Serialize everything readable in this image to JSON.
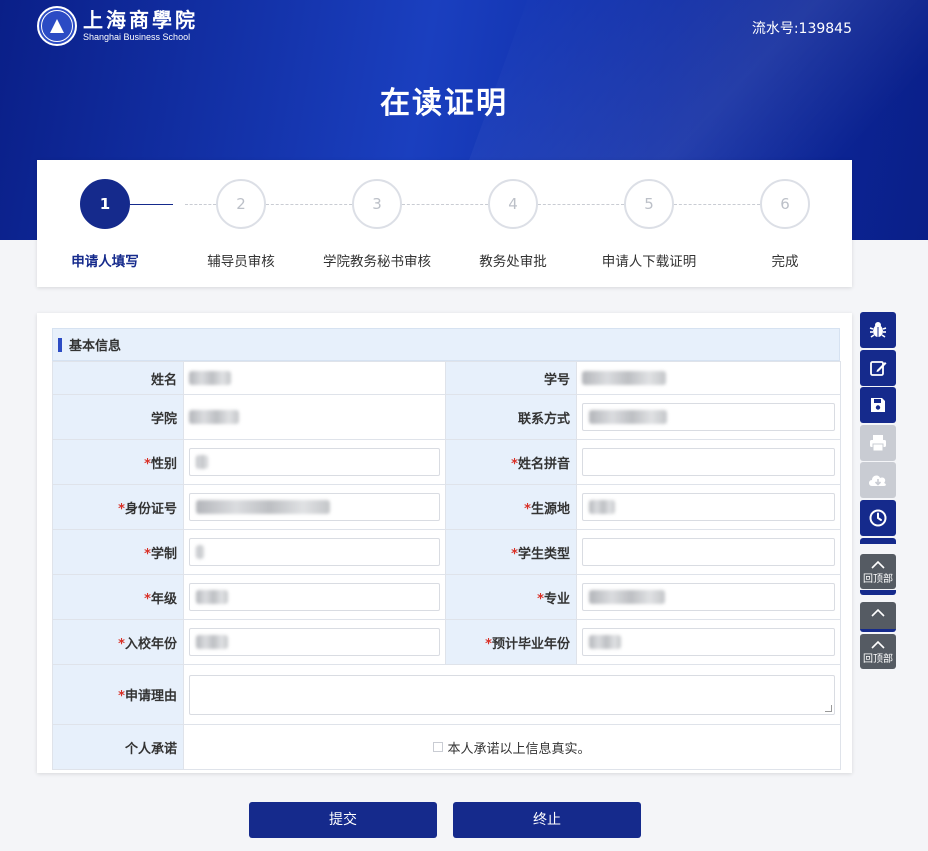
{
  "header": {
    "logo_cn": "上海商學院",
    "logo_en": "Shanghai Business School",
    "serial_label": "流水号:",
    "serial_value": "139845",
    "title": "在读证明"
  },
  "steps": [
    {
      "num": "1",
      "label": "申请人填写",
      "active": true
    },
    {
      "num": "2",
      "label": "辅导员审核",
      "active": false
    },
    {
      "num": "3",
      "label": "学院教务秘书审核",
      "active": false
    },
    {
      "num": "4",
      "label": "教务处审批",
      "active": false
    },
    {
      "num": "5",
      "label": "申请人下载证明",
      "active": false
    },
    {
      "num": "6",
      "label": "完成",
      "active": false
    }
  ],
  "form": {
    "section_title": "基本信息",
    "rows": [
      {
        "left_label": "姓名",
        "right_label": "学号"
      },
      {
        "left_label": "学院",
        "right_label": "联系方式"
      },
      {
        "left_label": "性别",
        "right_label": "姓名拼音"
      },
      {
        "left_label": "身份证号",
        "right_label": "生源地"
      },
      {
        "left_label": "学制",
        "right_label": "学生类型"
      },
      {
        "left_label": "年级",
        "right_label": "专业"
      },
      {
        "left_label": "入校年份",
        "right_label": "预计毕业年份"
      }
    ],
    "reason_label": "申请理由",
    "promise_label": "个人承诺",
    "promise_text": "本人承诺以上信息真实。",
    "required_mark": "*"
  },
  "actions": {
    "submit": "提交",
    "terminate": "终止"
  },
  "sidebar": {
    "tools": [
      "bug-icon",
      "edit-icon",
      "save-icon",
      "print-icon",
      "cloud-download-icon",
      "clock-icon"
    ],
    "back_top_label": "回顶部"
  },
  "colors": {
    "primary": "#152a8c",
    "required": "#d93026",
    "label_bg": "#e7f0fb"
  }
}
